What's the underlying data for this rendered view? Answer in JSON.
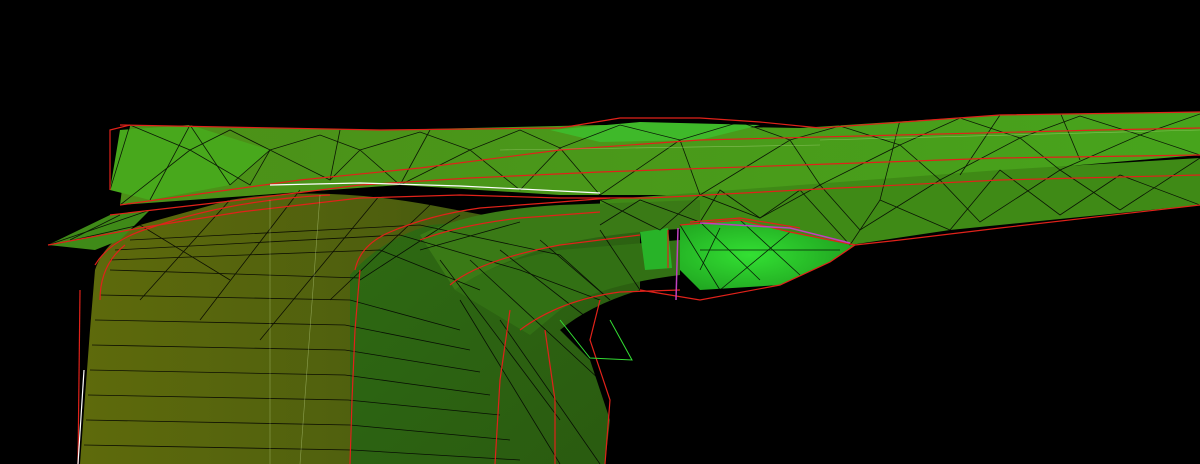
{
  "viewport": {
    "background": "#000000",
    "render_mode": "shaded-wireframe",
    "surface_colors": [
      "#2b5a12",
      "#3f7a17",
      "#55a81c",
      "#2fcc2f",
      "#6b6a0e"
    ],
    "mesh_edge_color": "#000000",
    "boundary_edge_color": "#e0221a",
    "highlight_edge_color": "#ffffff",
    "selection_edge_color": "#c040c0"
  }
}
